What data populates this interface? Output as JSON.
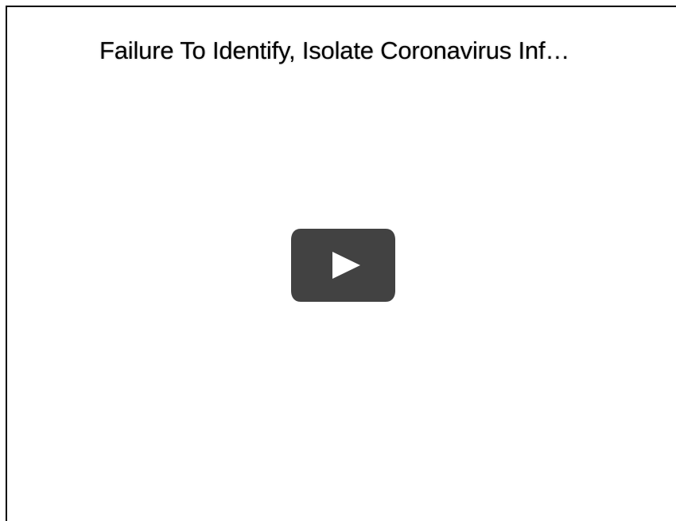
{
  "video": {
    "title": "Failure To Identify, Isolate Coronavirus Inf…",
    "play_icon": "youtube-play-icon"
  },
  "colors": {
    "play_button_bg": "#424242",
    "play_arrow": "#ffffff",
    "frame_border": "#000000",
    "background": "#ffffff"
  }
}
